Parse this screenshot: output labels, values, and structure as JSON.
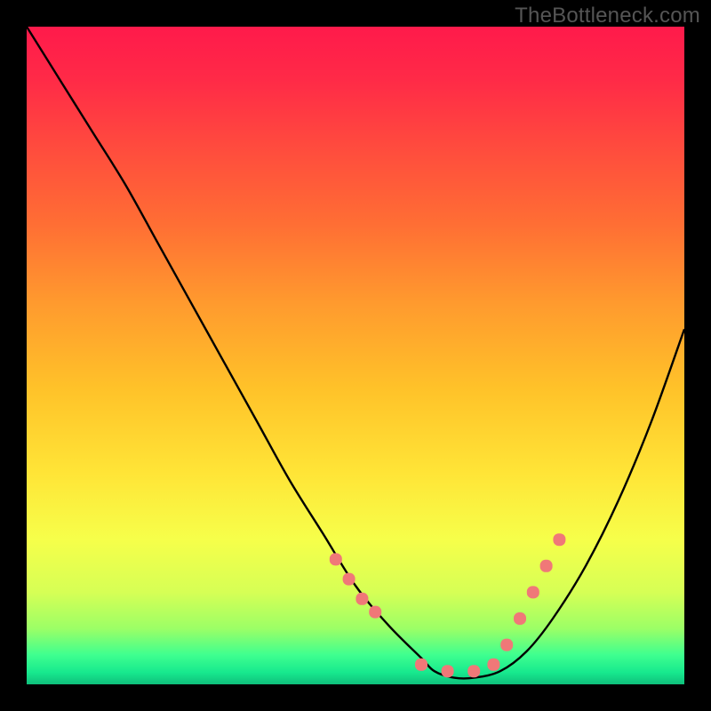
{
  "watermark": "TheBottleneck.com",
  "chart_data": {
    "type": "line",
    "title": "",
    "xlabel": "",
    "ylabel": "",
    "xlim": [
      0,
      100
    ],
    "ylim": [
      0,
      100
    ],
    "series": [
      {
        "name": "curve",
        "x": [
          0,
          5,
          10,
          15,
          20,
          25,
          30,
          35,
          40,
          45,
          50,
          55,
          60,
          62,
          65,
          68,
          72,
          76,
          80,
          85,
          90,
          95,
          100
        ],
        "y": [
          100,
          92,
          84,
          76,
          67,
          58,
          49,
          40,
          31,
          23,
          15,
          9,
          4,
          2,
          1,
          1,
          2,
          5,
          10,
          18,
          28,
          40,
          54
        ]
      }
    ],
    "markers": {
      "name": "dots",
      "x": [
        47,
        49,
        51,
        53,
        60,
        64,
        68,
        71,
        73,
        75,
        77,
        79,
        81
      ],
      "y": [
        19,
        16,
        13,
        11,
        3,
        2,
        2,
        3,
        6,
        10,
        14,
        18,
        22
      ]
    },
    "gradient_stops": [
      {
        "offset": 0.0,
        "color": "#ff1a4b"
      },
      {
        "offset": 0.08,
        "color": "#ff2a47"
      },
      {
        "offset": 0.18,
        "color": "#ff4a3e"
      },
      {
        "offset": 0.3,
        "color": "#ff6e34"
      },
      {
        "offset": 0.42,
        "color": "#ff9a2e"
      },
      {
        "offset": 0.55,
        "color": "#ffc229"
      },
      {
        "offset": 0.68,
        "color": "#ffe537"
      },
      {
        "offset": 0.78,
        "color": "#f6ff4a"
      },
      {
        "offset": 0.86,
        "color": "#d6ff55"
      },
      {
        "offset": 0.915,
        "color": "#9cff66"
      },
      {
        "offset": 0.955,
        "color": "#3fff8f"
      },
      {
        "offset": 0.982,
        "color": "#17e98e"
      },
      {
        "offset": 1.0,
        "color": "#0fbf7b"
      }
    ],
    "marker_color": "#f07878",
    "curve_color": "#000000"
  }
}
